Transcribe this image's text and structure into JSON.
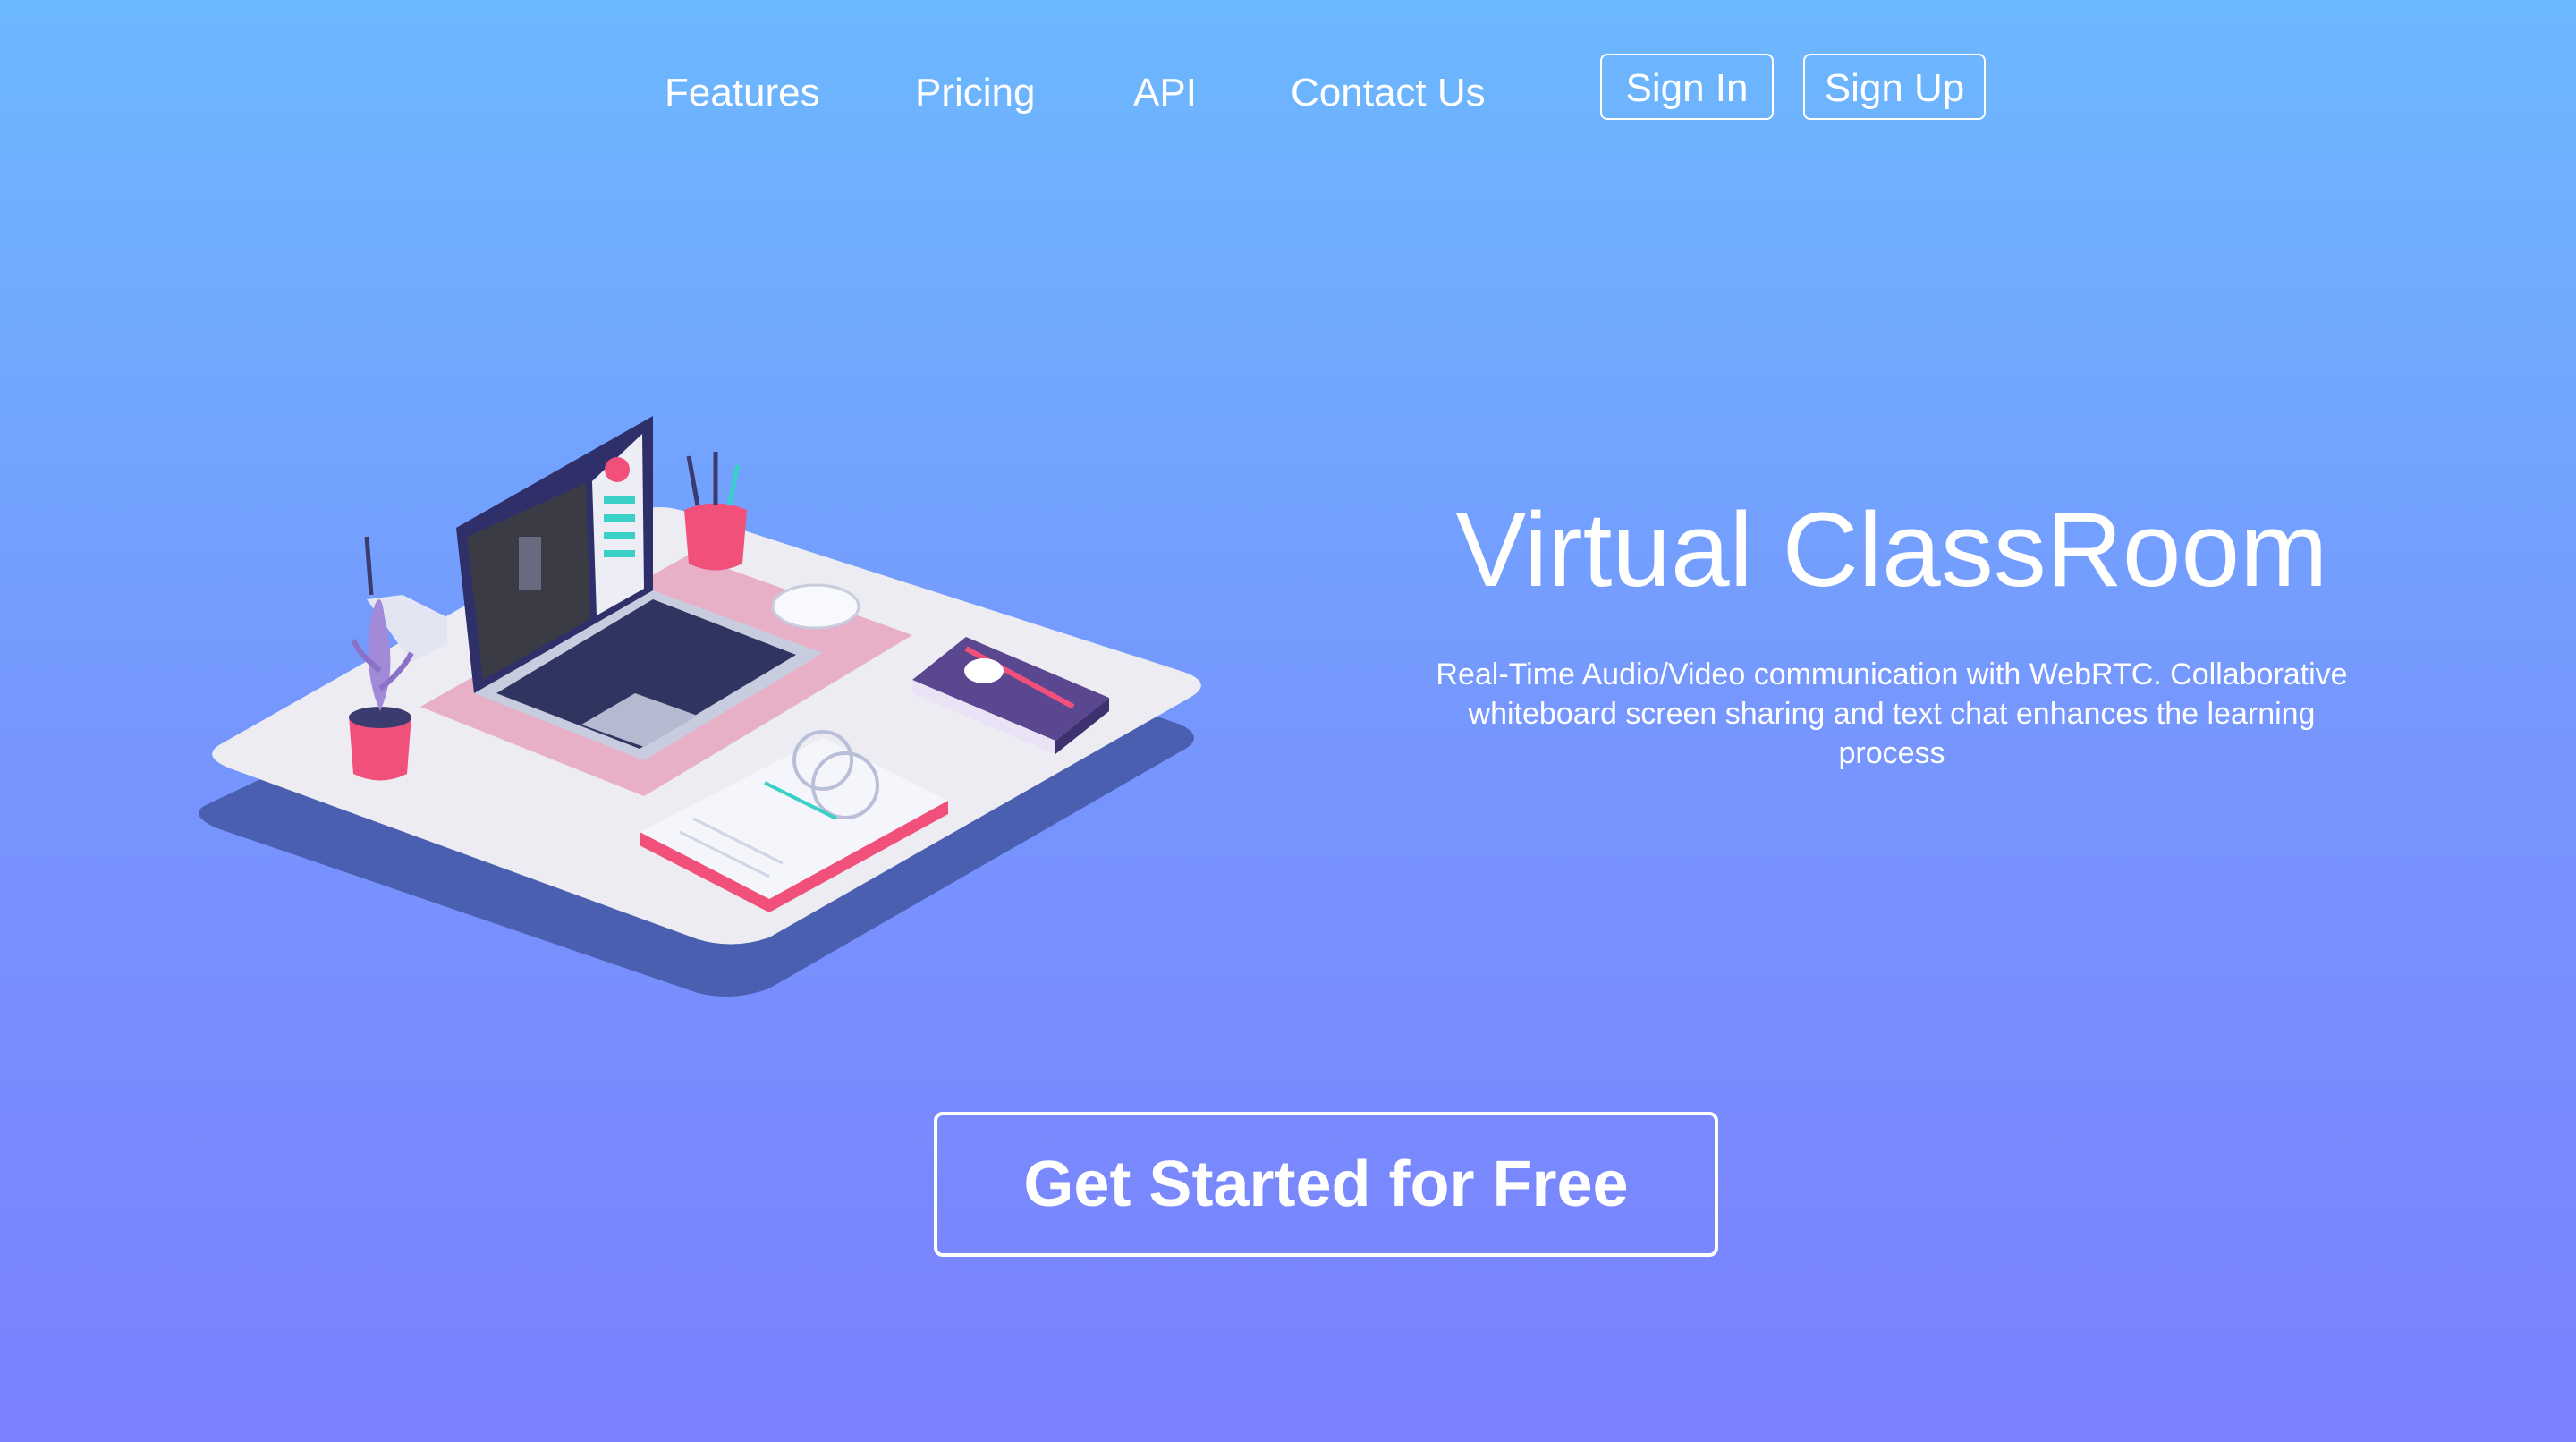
{
  "nav": {
    "links": [
      {
        "label": "Features"
      },
      {
        "label": "Pricing"
      },
      {
        "label": "API"
      },
      {
        "label": "Contact Us"
      }
    ],
    "sign_in_label": "Sign In",
    "sign_up_label": "Sign Up"
  },
  "hero": {
    "title": "Virtual ClassRoom",
    "description": "Real-Time Audio/Video communication with WebRTC. Collaborative whiteboard screen sharing and text chat enhances the learning process"
  },
  "cta": {
    "label": "Get Started for Free"
  },
  "colors": {
    "gradient_top": "#6cb8fe",
    "gradient_bottom": "#7b80fd",
    "desk_top": "#ececf2",
    "desk_shadow": "#4a5fb0",
    "accent_pink": "#f0507a",
    "laptop": "#3a3a7a"
  },
  "icons": {
    "illustration": "desk-illustration"
  }
}
